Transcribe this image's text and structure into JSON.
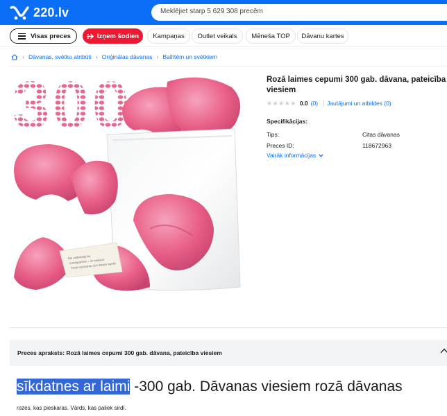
{
  "header": {
    "logo_text": "220.lv",
    "search_placeholder": "Meklējiet starp 5 629 308 precēm",
    "brand_color": "#0a6ef6"
  },
  "nav": {
    "catalog_label": "Visas preces",
    "hot_label": "Izņem šodien",
    "hot_color": "#ef1832",
    "items": [
      "Kampaņas",
      "Outlet veikals",
      "Mēneša TOP",
      "Dāvanu kartes"
    ]
  },
  "breadcrumbs": [
    "Dāvanas, svētku atribūti",
    "Oriģinālas dāvanas",
    "Ballītēm un svētkiem"
  ],
  "product": {
    "title": "Rozā laimes cepumi 300 gab. dāvana, pateicība viesiem",
    "rating_value": "0.0",
    "reviews_count": "(0)",
    "qa_link": "Jautājumi un atbildes (0)",
    "spec_title": "Specifikācijas:",
    "specs": [
      {
        "label": "Tips:",
        "value": "Citas dāvanas"
      },
      {
        "label": "Preces ID:",
        "value": "118672963"
      }
    ],
    "more_info": "Vairāk informācijas",
    "image_number": "300",
    "paper_text": "Nie zadowalaj się rozwiązaniem – im większe Twoje wyzwania, tym lepsze wyniki"
  },
  "description": {
    "bar_title": "Preces apraksts: Rozā laimes cepumi 300 gab. dāvana, pateicība viesiem",
    "heading_highlight": "sīkdatnes ar laimi",
    "heading_rest": " -300 gab. Dāvanas viesiem rozā dāvanas",
    "body": "rozes, kas pieskaras. Vārds, kas paliek sirdī."
  }
}
